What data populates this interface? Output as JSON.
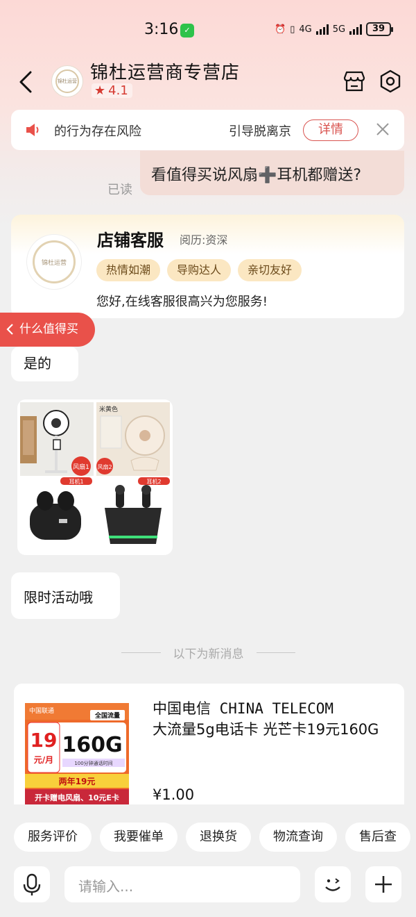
{
  "status_bar": {
    "time": "3:16",
    "wechat_icon": "wechat-icon",
    "net1": "4G",
    "net2": "5G",
    "battery": "39"
  },
  "header": {
    "store_name": "锦杜运营商专营店",
    "rating": "4.1",
    "store_logo_text": "锦杜运营"
  },
  "notice": {
    "text_left": "的行为存在风险",
    "text_right": "引导脱离京",
    "detail_label": "详情"
  },
  "messages": {
    "outgoing": "看值得买说风扇➕耳机都赠送?",
    "read_status": "已读",
    "reply_yes": "是的",
    "reply_limited": "限时活动哦",
    "new_divider": "以下为新消息"
  },
  "agent": {
    "title": "店铺客服",
    "level": "阅历:资深",
    "tags": [
      "热情如潮",
      "导购达人",
      "亲切友好"
    ],
    "greeting": "您好,在线客服很高兴为您服务!",
    "logo_text": "锦杜运营"
  },
  "float_tag": {
    "label": "什么值得买"
  },
  "image_card": {
    "fan_label": "米黄色",
    "badge_fan1": "风扇1",
    "badge_fan2": "风扇2",
    "badge_ear1": "耳机1",
    "badge_ear2": "耳机2"
  },
  "product": {
    "title_line1": "中国电信 CHINA TELECOM",
    "title_line2": "大流量5g电话卡 光芒卡19元160G",
    "price": "¥1.00",
    "thumb": {
      "brand": "中国联通",
      "tag": "全国流量",
      "price_num": "19",
      "price_unit": "元/月",
      "data": "160G",
      "minutes": "100分钟通话时间",
      "promo1": "两年19元",
      "promo2": "开卡赠电风扇、10元E卡"
    }
  },
  "quick_actions": [
    "服务评价",
    "我要催单",
    "退换货",
    "物流查询",
    "售后查"
  ],
  "input": {
    "placeholder": "请输入..."
  },
  "colors": {
    "accent": "#e9514a",
    "tag_bg": "#fbe7c2",
    "bubble_out": "#f3ddd7"
  }
}
